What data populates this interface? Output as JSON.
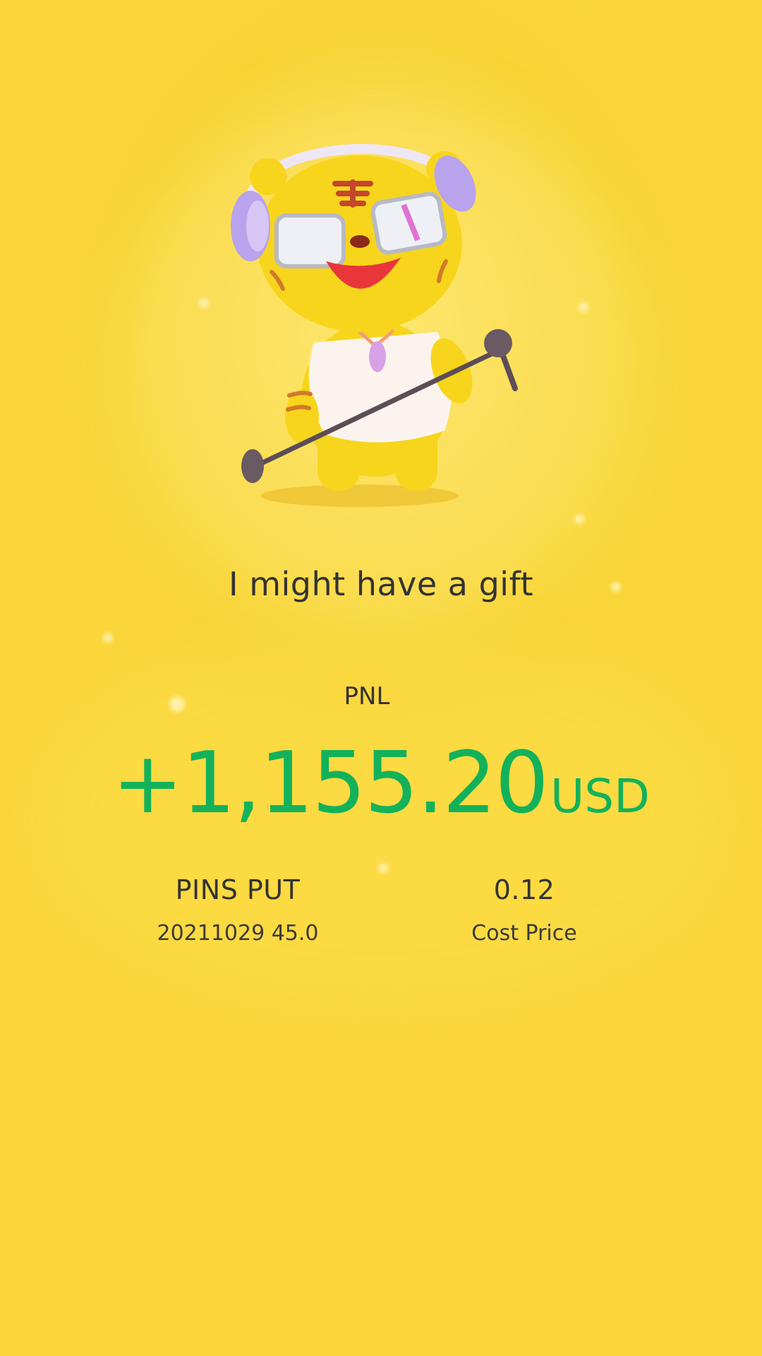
{
  "mascot": {
    "icon": "tiger-mascot-with-headphones-and-microphone-icon"
  },
  "headline": "I might have a gift",
  "pnl": {
    "label": "PNL",
    "amount": "+1,155.20",
    "currency": "USD",
    "color": "#13b25a"
  },
  "position": {
    "symbol": "PINS PUT",
    "contract": "20211029 45.0"
  },
  "cost": {
    "value": "0.12",
    "label": "Cost Price"
  },
  "colors": {
    "background": "#f9d847",
    "text": "#333333",
    "profit": "#13b25a"
  }
}
